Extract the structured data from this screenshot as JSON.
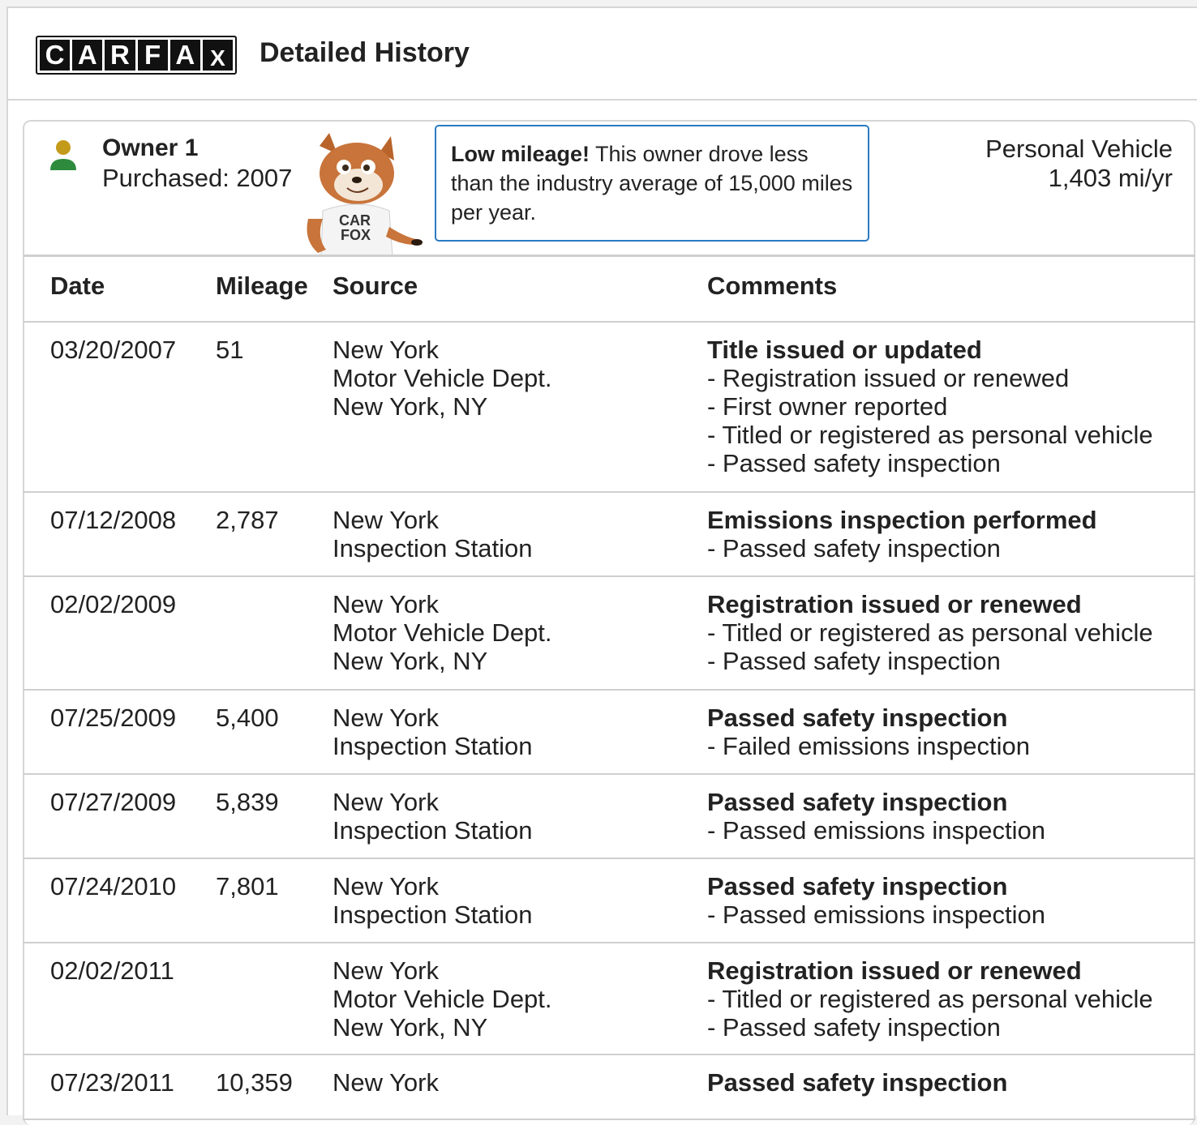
{
  "header": {
    "logo_letters": [
      "C",
      "A",
      "R",
      "F",
      "A",
      "X"
    ],
    "title": "Detailed History"
  },
  "owner": {
    "title": "Owner 1",
    "purchased": "Purchased: 2007",
    "icon": "person-icon",
    "mascot": "car-fox-mascot",
    "callout": {
      "bold": "Low mileage!",
      "text": " This owner drove less than the industry average of 15,000 miles per year."
    },
    "vehicle_type": "Personal Vehicle",
    "miles_per_year": "1,403 mi/yr"
  },
  "table": {
    "columns": [
      "Date",
      "Mileage",
      "Source",
      "Comments"
    ],
    "rows": [
      {
        "date": "03/20/2007",
        "mileage": "51",
        "source": [
          "New York",
          "Motor Vehicle Dept.",
          "New York, NY"
        ],
        "comment_title": "Title issued or updated",
        "comments": [
          "- Registration issued or renewed",
          "- First owner reported",
          "- Titled or registered as personal vehicle",
          "- Passed safety inspection"
        ]
      },
      {
        "date": "07/12/2008",
        "mileage": "2,787",
        "source": [
          "New York",
          "Inspection Station"
        ],
        "comment_title": "Emissions inspection performed",
        "comments": [
          "- Passed safety inspection"
        ]
      },
      {
        "date": "02/02/2009",
        "mileage": "",
        "source": [
          "New York",
          "Motor Vehicle Dept.",
          "New York, NY"
        ],
        "comment_title": "Registration issued or renewed",
        "comments": [
          "- Titled or registered as personal vehicle",
          "- Passed safety inspection"
        ]
      },
      {
        "date": "07/25/2009",
        "mileage": "5,400",
        "source": [
          "New York",
          "Inspection Station"
        ],
        "comment_title": "Passed safety inspection",
        "comments": [
          "- Failed emissions inspection"
        ]
      },
      {
        "date": "07/27/2009",
        "mileage": "5,839",
        "source": [
          "New York",
          "Inspection Station"
        ],
        "comment_title": "Passed safety inspection",
        "comments": [
          "- Passed emissions inspection"
        ]
      },
      {
        "date": "07/24/2010",
        "mileage": "7,801",
        "source": [
          "New York",
          "Inspection Station"
        ],
        "comment_title": "Passed safety inspection",
        "comments": [
          "- Passed emissions inspection"
        ]
      },
      {
        "date": "02/02/2011",
        "mileage": "",
        "source": [
          "New York",
          "Motor Vehicle Dept.",
          "New York, NY"
        ],
        "comment_title": "Registration issued or renewed",
        "comments": [
          "- Titled or registered as personal vehicle",
          "- Passed safety inspection"
        ]
      },
      {
        "date": "07/23/2011",
        "mileage": "10,359",
        "source": [
          "New York"
        ],
        "comment_title": "Passed safety inspection",
        "comments": []
      }
    ]
  },
  "colors": {
    "accent_blue": "#2a7ac4",
    "owner_icon_head": "#c49a1b",
    "owner_icon_body": "#2e8b3e"
  }
}
